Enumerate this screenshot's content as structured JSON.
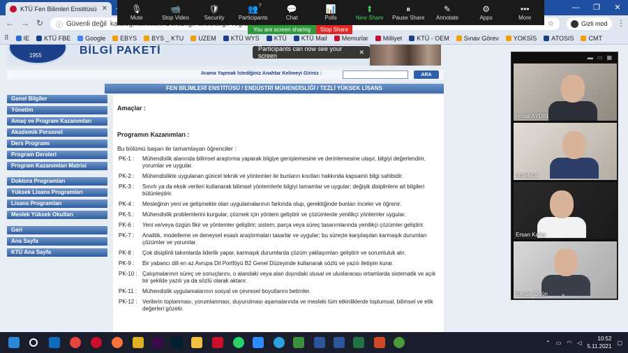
{
  "browser": {
    "tab_title": "KTÜ Fen Bilimleri Enstitüsü",
    "url_prefix": "Güvenli değil",
    "url": "katalog.ktu.edu.tr/DersBilgiPaketi/bilgiProgram...",
    "profile": "Gizli mod",
    "bookmarks": [
      {
        "label": "IE",
        "color": "#2b6cd4"
      },
      {
        "label": "KTÜ FBE",
        "color": "#1c3f8a"
      },
      {
        "label": "Google",
        "color": "#4285f4"
      },
      {
        "label": "EBYS",
        "color": "#f0a000"
      },
      {
        "label": "BYS _ KTU",
        "color": "#f0a000"
      },
      {
        "label": "UZEM",
        "color": "#f0a000"
      },
      {
        "label": "KTÜ WYS",
        "color": "#1c3f8a"
      },
      {
        "label": "KTÜ",
        "color": "#1c3f8a"
      },
      {
        "label": "KTÜ Mail",
        "color": "#1c3f8a"
      },
      {
        "label": "Memurlar",
        "color": "#c8102e"
      },
      {
        "label": "Milliyet",
        "color": "#c8102e"
      },
      {
        "label": "KTÜ - OEM",
        "color": "#1c3f8a"
      },
      {
        "label": "Sınav Görev",
        "color": "#f0a000"
      },
      {
        "label": "YOKSİS",
        "color": "#f0a000"
      },
      {
        "label": "ATOSIS",
        "color": "#1c3f8a"
      },
      {
        "label": "CMT",
        "color": "#f0a000"
      }
    ]
  },
  "zoom": {
    "buttons": [
      {
        "label": "Mute",
        "icon": "microphone-icon",
        "glyph": "🎙"
      },
      {
        "label": "Stop Video",
        "icon": "camera-icon",
        "glyph": "📹"
      },
      {
        "label": "Security",
        "icon": "shield-icon",
        "glyph": "🛡"
      },
      {
        "label": "Participants",
        "icon": "people-icon",
        "glyph": "👥",
        "count": "7"
      },
      {
        "label": "Chat",
        "icon": "chat-icon",
        "glyph": "💬"
      },
      {
        "label": "Polls",
        "icon": "polls-icon",
        "glyph": "📊"
      },
      {
        "label": "New Share",
        "icon": "share-icon",
        "glyph": "⬆"
      },
      {
        "label": "Pause Share",
        "icon": "pause-icon",
        "glyph": "⏸"
      },
      {
        "label": "Annotate",
        "icon": "pencil-icon",
        "glyph": "✎"
      },
      {
        "label": "Apps",
        "icon": "apps-icon",
        "glyph": "⚙"
      },
      {
        "label": "More",
        "icon": "more-icon",
        "glyph": "•••"
      }
    ],
    "sharing_text": "You are screen sharing",
    "stop_share": "Stop Share",
    "toast": "Participants can now see your screen",
    "participants": [
      {
        "name": "İsmail AYDIN"
      },
      {
        "name": "omtelatar"
      },
      {
        "name": "Ersan Kalay"
      },
      {
        "name": "Serdar Ödün"
      }
    ]
  },
  "site": {
    "banner_text": "BİLGİ PAKETİ",
    "logo_year": "1955",
    "search_label": "Arama Yapmak İstediğiniz Anahtar Kelimeyi Giriniz :",
    "search_button": "ARA",
    "path": "FEN BİLİMLERİ ENSTİTÜSÜ / ENDÜSTRİ MÜHENDİSLİĞİ / TEZLİ YÜKSEK LİSANS",
    "nav_groups": [
      {
        "items": [
          "Genel Bilgiler",
          "Yönetim",
          "Amaç ve Program Kazanımları",
          "Akademik Personel",
          "Ders Programı",
          "Program Dersleri",
          "Program Kazanımları Matrisi"
        ]
      },
      {
        "items": [
          "Doktora Programları",
          "Yüksek Lisans Programları",
          "Lisans Programları",
          "Meslek Yüksek Okulları"
        ]
      },
      {
        "items": [
          "Geri",
          "Ana Sayfa",
          "KTÜ Ana Sayfa"
        ]
      }
    ],
    "heading_aim": "Amaçlar :",
    "heading_outcomes": "Programın Kazanımları :",
    "intro": "Bu bölümü başarı ile tamamlayan öğrenciler :",
    "outcomes": [
      {
        "code": "PK-1 :",
        "text": "Mühendislik alanında bilimsel araştırma yaparak bilgiye genişlemesine ve derinlemesine ulaşır, bilgiyi değerlendirir, yorumlar ve uygular."
      },
      {
        "code": "PK-2 :",
        "text": "Mühendislikte uygulanan güncel teknik ve yöntemler ile bunların kısıtları hakkında kapsamlı bilgi sahibidir."
      },
      {
        "code": "PK-3 :",
        "text": "Sınırlı ya da eksik verileri kullanarak bilimsel yöntemlerle bilgiyi tamamlar ve uygular; değişik disiplinlere ait bilgileri bütünleştirir."
      },
      {
        "code": "PK-4 :",
        "text": "Mesleğinin yeni ve gelişmekte olan uygulamalarının farkında olup, gerektiğinde bunları inceler ve öğrenir."
      },
      {
        "code": "PK-5 :",
        "text": "Mühendislik problemlerini kurgular, çözmek için yöntem geliştirir ve çözümlerde yenilikçi yöntemler uygular."
      },
      {
        "code": "PK-6 :",
        "text": "Yeni ve/veya özgün fikir ve yöntemler geliştirir; sistem, parça veya süreç tasarımlarında yenilikçi çözümler geliştirir."
      },
      {
        "code": "PK-7 :",
        "text": "Analitik, modelleme ve deneysel esaslı araştırmaları tasarlar ve uygular; bu süreçte karşılaşılan karmaşık durumları çözümler ve yorumlar."
      },
      {
        "code": "PK-8 :",
        "text": "Çok disiplinli takımlarda liderlik yapar, karmaşık durumlarda çözüm yaklaşımları geliştirir ve sorumluluk alır."
      },
      {
        "code": "PK-9 :",
        "text": "Bir yabancı dili en az Avrupa Dil Portföyü B2 Genel Düzeyinde kullanarak sözlü ve yazılı iletişim kurar."
      },
      {
        "code": "PK-10 :",
        "text": "Çalışmalarının süreç ve sonuçlarını, o alandaki veya alan dışındaki ulusal ve uluslararası ortamlarda sistematik ve açık bir şekilde yazılı ya da sözlü olarak aktarır."
      },
      {
        "code": "PK-11 :",
        "text": "Mühendislik uygulamalarının sosyal ve çevresel boyutlarını betimler."
      },
      {
        "code": "PK-12 :",
        "text": "Verilerin toplanması, yorumlanması, duyurulması aşamalarında ve mesleki tüm etkinliklerde toplumsal, bilimsel ve etik değerleri gözetir."
      }
    ]
  },
  "taskbar": {
    "time": "10:52",
    "date": "5.11.2021"
  }
}
